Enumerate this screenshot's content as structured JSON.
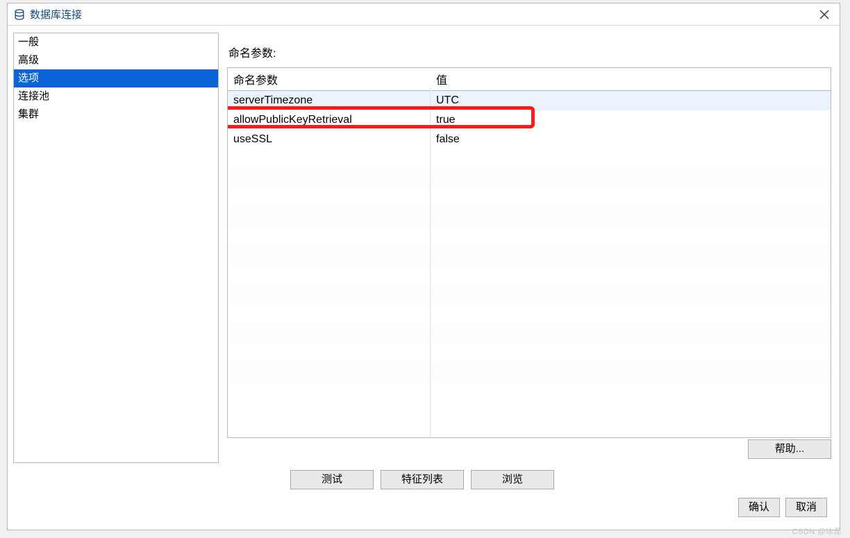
{
  "window": {
    "title": "数据库连接"
  },
  "sidebar": {
    "items": [
      {
        "label": "一般",
        "selected": false
      },
      {
        "label": "高级",
        "selected": false
      },
      {
        "label": "选项",
        "selected": true
      },
      {
        "label": "连接池",
        "selected": false
      },
      {
        "label": "集群",
        "selected": false
      }
    ]
  },
  "panel": {
    "section_label": "命名参数:",
    "columns": {
      "name": "命名参数",
      "value": "值"
    },
    "rows": [
      {
        "name": "serverTimezone",
        "value": "UTC",
        "selected": true,
        "highlighted": false
      },
      {
        "name": "allowPublicKeyRetrieval",
        "value": "true",
        "selected": false,
        "highlighted": true
      },
      {
        "name": "useSSL",
        "value": "false",
        "selected": false,
        "highlighted": false
      }
    ],
    "empty_row_count": 13
  },
  "buttons": {
    "help": "帮助...",
    "test": "测试",
    "featureList": "特征列表",
    "browse": "浏览",
    "ok": "确认",
    "cancel": "取消"
  },
  "watermark": "CSDN @冰蕊"
}
